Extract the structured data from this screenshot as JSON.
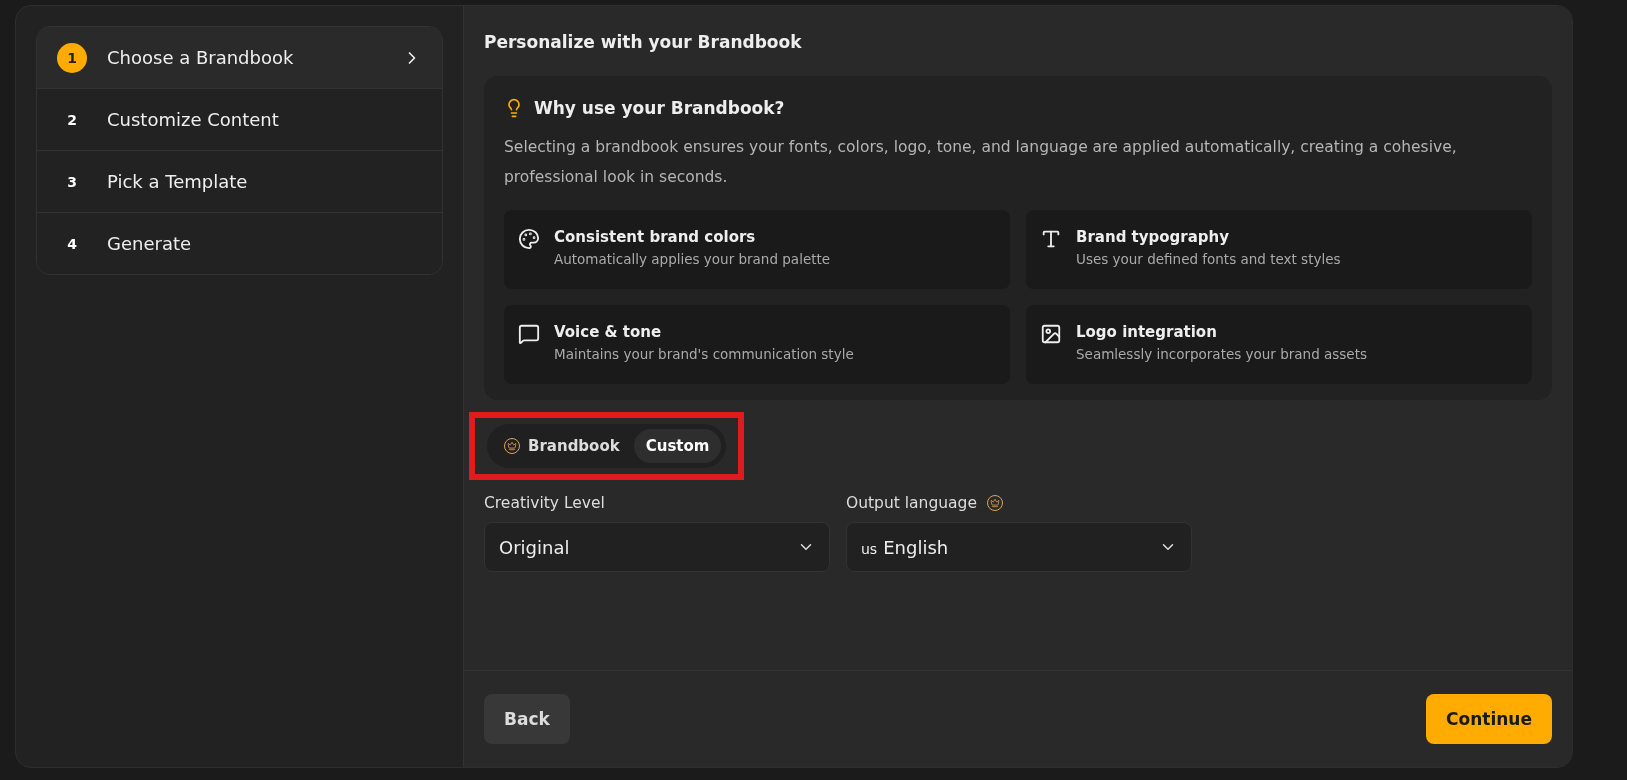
{
  "steps": [
    {
      "number": "1",
      "label": "Choose a Brandbook",
      "selected": true
    },
    {
      "number": "2",
      "label": "Customize Content",
      "selected": false
    },
    {
      "number": "3",
      "label": "Pick a Template",
      "selected": false
    },
    {
      "number": "4",
      "label": "Generate",
      "selected": false
    }
  ],
  "heading": "Personalize with your Brandbook",
  "info": {
    "title": "Why use your Brandbook?",
    "description": "Selecting a brandbook ensures your fonts, colors, logo, tone, and language are applied automatically, creating a cohesive, professional look in seconds.",
    "features": [
      {
        "kind": "palette",
        "title": "Consistent brand colors",
        "subtitle": "Automatically applies your brand palette"
      },
      {
        "kind": "type",
        "title": "Brand typography",
        "subtitle": "Uses your defined fonts and text styles"
      },
      {
        "kind": "chat",
        "title": "Voice & tone",
        "subtitle": "Maintains your brand's communication style"
      },
      {
        "kind": "image",
        "title": "Logo integration",
        "subtitle": "Seamlessly incorporates your brand assets"
      }
    ]
  },
  "mode_toggle": {
    "highlighted": true,
    "options": [
      {
        "label": "Brandbook",
        "premium": true,
        "selected": false
      },
      {
        "label": "Custom",
        "premium": false,
        "selected": true
      }
    ]
  },
  "fields": [
    {
      "label": "Creativity Level",
      "premium": false,
      "value": "Original"
    },
    {
      "label": "Output language",
      "premium": true,
      "flag": "us",
      "value": "English"
    }
  ],
  "buttons": {
    "back": "Back",
    "continue": "Continue"
  }
}
